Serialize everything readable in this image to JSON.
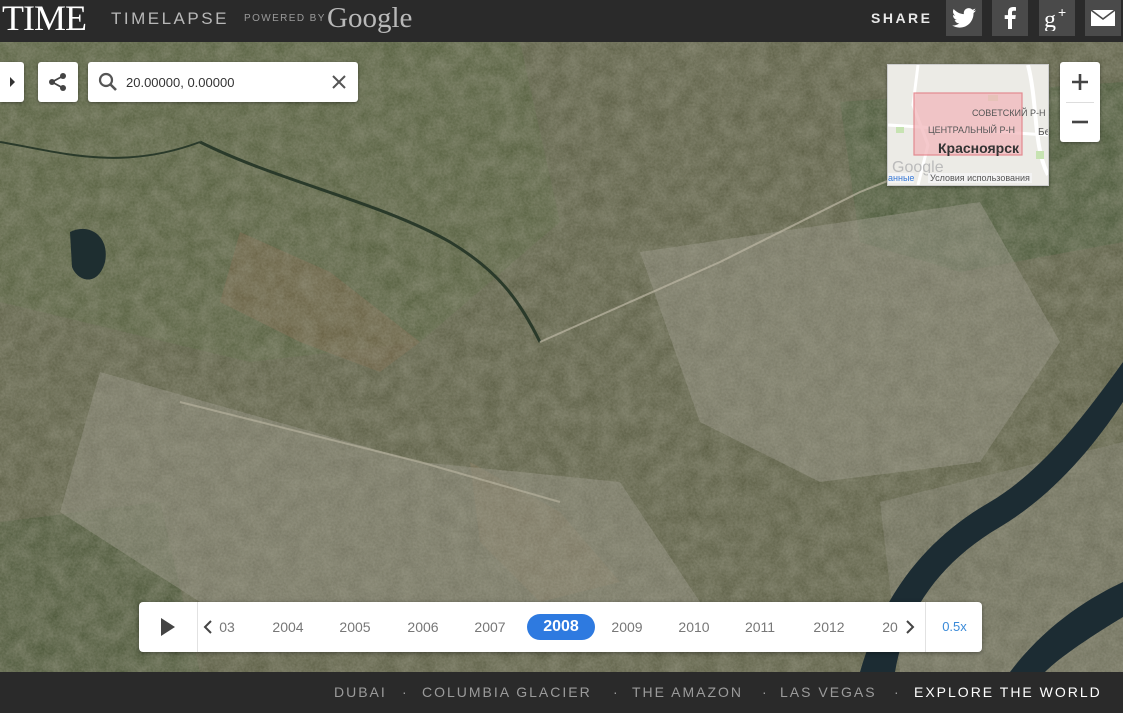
{
  "header": {
    "logo": "TIME",
    "product": "TIMELAPSE",
    "powered_by": "POWERED BY",
    "google": "Google",
    "share_label": "SHARE",
    "share_buttons": [
      "twitter-icon",
      "facebook-icon",
      "google-plus-icon",
      "email-icon"
    ]
  },
  "search": {
    "value": "20.00000, 0.00000"
  },
  "minimap": {
    "city": "Красноярск",
    "district_1": "СОВЕТСКИЙ Р-Н",
    "district_2": "ЦЕНТРАЛЬНЫЙ Р-Н",
    "edge_text": "Бе",
    "attribution_left": "анные",
    "terms": "Условия использования",
    "google_watermark": "Google"
  },
  "timeline": {
    "years": [
      "03",
      "2004",
      "2005",
      "2006",
      "2007",
      "2008",
      "2009",
      "2010",
      "2011",
      "2012",
      "20"
    ],
    "selected": "2008",
    "speed": "0.5x"
  },
  "footer": {
    "links": [
      "DUBAI",
      "COLUMBIA GLACIER",
      "THE AMAZON",
      "LAS VEGAS"
    ],
    "explore": "EXPLORE THE WORLD",
    "separator": "·"
  },
  "colors": {
    "header_bg": "#2a2a2a",
    "accent": "#2e7ae0",
    "speed": "#3a8ad8"
  }
}
